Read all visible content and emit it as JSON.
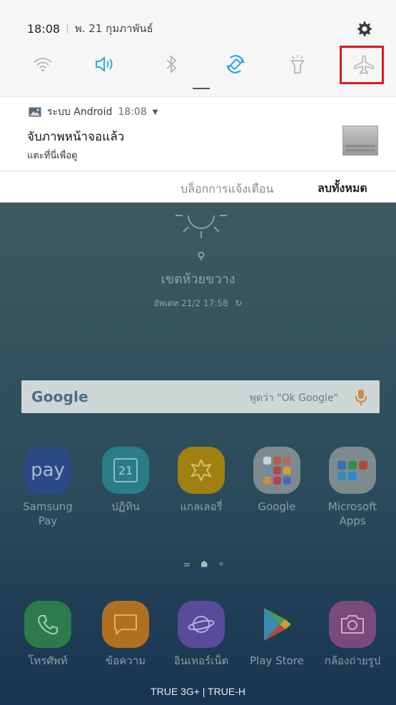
{
  "status_bar": {
    "time": "18:08",
    "date": "พ. 21 กุมภาพันธ์"
  },
  "quick_settings": {
    "items": [
      {
        "name": "wifi-icon",
        "active": false
      },
      {
        "name": "sound-icon",
        "active": true
      },
      {
        "name": "bluetooth-icon",
        "active": false
      },
      {
        "name": "auto-rotate-icon",
        "active": true
      },
      {
        "name": "flashlight-icon",
        "active": false
      },
      {
        "name": "airplane-mode-icon",
        "active": false,
        "highlighted": true
      }
    ],
    "accent": "#29a8e0",
    "highlight_color": "#e0161f"
  },
  "notification": {
    "app": "ระบบ Android",
    "time": "18:08",
    "title": "จับภาพหน้าจอแล้ว",
    "subtitle": "แตะที่นี่เพื่อดู"
  },
  "actions": {
    "block": "บล็อกการแจ้งเตือน",
    "clear_all": "ลบทั้งหมด"
  },
  "weather": {
    "location": "เขตห้วยขวาง",
    "updated": "อัพเดท 21/2 17:58"
  },
  "google_bar": {
    "logo": "Google",
    "hint": "พูดว่า \"Ok Google\""
  },
  "apps": [
    {
      "label": "Samsung Pay",
      "icon_text": "pay"
    },
    {
      "label": "ปฏิทิน",
      "icon_text": "21"
    },
    {
      "label": "แกลเลอรี่"
    },
    {
      "label": "Google"
    },
    {
      "label": "Microsoft Apps"
    }
  ],
  "dock": [
    {
      "label": "โทรศัพท์"
    },
    {
      "label": "ข้อความ"
    },
    {
      "label": "อินเทอร์เน็ต"
    },
    {
      "label": "Play Store"
    },
    {
      "label": "กล้องถ่ายรูป"
    }
  ],
  "carrier": "TRUE 3G+ | TRUE-H"
}
